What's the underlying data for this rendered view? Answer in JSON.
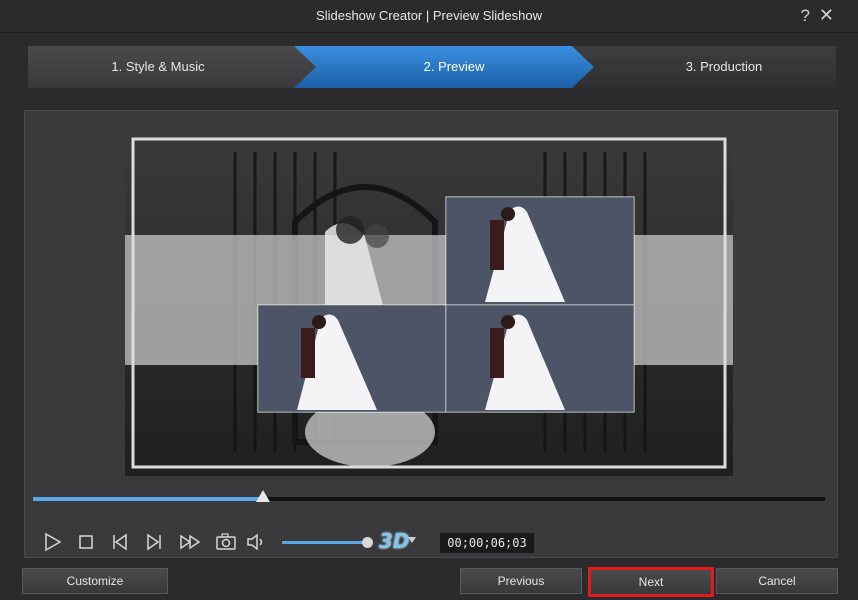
{
  "window": {
    "title": "Slideshow Creator | Preview Slideshow",
    "help_label": "?",
    "close_label": "✕"
  },
  "steps": [
    {
      "label": "1. Style & Music"
    },
    {
      "label": "2. Preview"
    },
    {
      "label": "3. Production"
    }
  ],
  "player": {
    "progress": 0.29,
    "volume": 0.95,
    "timecode": "00;00;06;03",
    "badge_3d": "3D",
    "icons": [
      "play-icon",
      "stop-icon",
      "previous-frame-icon",
      "next-frame-icon",
      "fast-forward-icon",
      "snapshot-icon",
      "volume-icon"
    ]
  },
  "buttons": {
    "customize": "Customize",
    "previous": "Previous",
    "next": "Next",
    "cancel": "Cancel"
  },
  "colors": {
    "accent": "#3a8fe0",
    "highlight": "#e21b1b"
  }
}
